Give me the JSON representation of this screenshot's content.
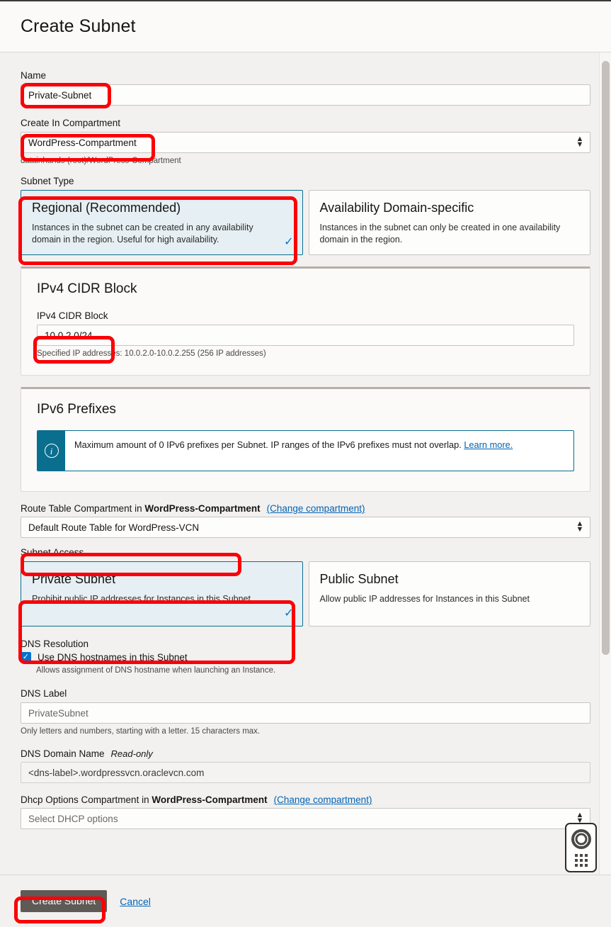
{
  "header": {
    "title": "Create Subnet"
  },
  "form": {
    "name": {
      "label": "Name",
      "value": "Private-Subnet"
    },
    "compartment": {
      "label": "Create In Compartment",
      "value": "WordPress-Compartment",
      "helper": "datainhands (root)/WordPress-Compartment"
    },
    "subnet_type": {
      "label": "Subnet Type",
      "options": [
        {
          "title": "Regional (Recommended)",
          "description": "Instances in the subnet can be created in any availability domain in the region. Useful for high availability.",
          "selected": true,
          "check": "✓"
        },
        {
          "title": "Availability Domain-specific",
          "description": "Instances in the subnet can only be created in one availability domain in the region.",
          "selected": false,
          "check": ""
        }
      ]
    },
    "ipv4_panel": {
      "heading": "IPv4 CIDR Block",
      "field_label": "IPv4 CIDR Block",
      "value": "10.0.2.0/24",
      "helper": "Specified IP addresses: 10.0.2.0-10.0.2.255 (256 IP addresses)"
    },
    "ipv6_panel": {
      "heading": "IPv6 Prefixes",
      "info_icon": "info-icon",
      "info_text": "Maximum amount of 0 IPv6 prefixes per Subnet. IP ranges of the IPv6 prefixes must not overlap.",
      "info_link": "Learn more."
    },
    "route_table": {
      "label_prefix": "Route Table Compartment in",
      "label_bold": "WordPress-Compartment",
      "change_link": "(Change compartment)",
      "value": "Default Route Table for WordPress-VCN"
    },
    "subnet_access": {
      "label": "Subnet Access",
      "options": [
        {
          "title": "Private Subnet",
          "description": "Prohibit public IP addresses for Instances in this Subnet",
          "selected": true,
          "check": "✓"
        },
        {
          "title": "Public Subnet",
          "description": "Allow public IP addresses for Instances in this Subnet",
          "selected": false,
          "check": ""
        }
      ]
    },
    "dns_resolution": {
      "label": "DNS Resolution",
      "checkbox_label": "Use DNS hostnames in this Subnet",
      "checkbox_checked": true,
      "check_glyph": "✓",
      "helper": "Allows assignment of DNS hostname when launching an Instance."
    },
    "dns_label": {
      "label": "DNS Label",
      "placeholder": "PrivateSubnet",
      "helper": "Only letters and numbers, starting with a letter. 15 characters max."
    },
    "dns_domain": {
      "label": "DNS Domain Name",
      "readonly_tag": "Read-only",
      "value": "<dns-label>.wordpressvcn.oraclevcn.com"
    },
    "dhcp": {
      "label_prefix": "Dhcp Options Compartment in",
      "label_bold": "WordPress-Compartment",
      "change_link": "(Change compartment)",
      "placeholder": "Select DHCP options"
    }
  },
  "footer": {
    "submit_label": "Create Subnet",
    "cancel_label": "Cancel"
  },
  "help_widget": {
    "icon": "life-ring-icon",
    "handle": "drag-handle-dots"
  },
  "colors": {
    "annotation": "#fb0007",
    "accent_blue": "#0572ce",
    "link_blue": "#0063b3",
    "info_teal": "#0a6e8f",
    "selected_card_bg": "#e6eff3",
    "primary_button": "#5f5a56"
  }
}
